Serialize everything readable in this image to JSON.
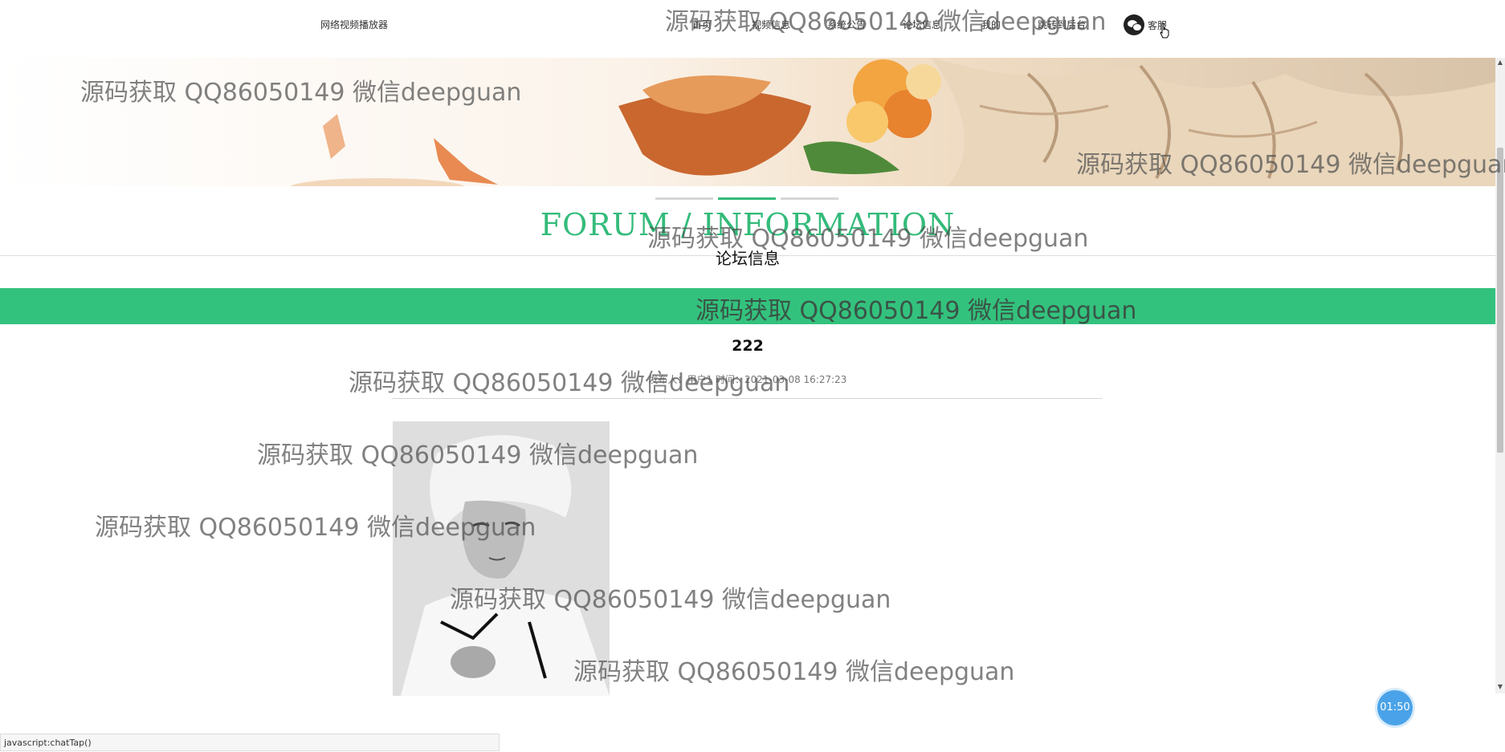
{
  "nav": {
    "brand": "网络视频播放器",
    "links": [
      "首页",
      "视频信息",
      "系统公告",
      "论坛信息",
      "我的",
      "跳转到后台"
    ],
    "service_label": "客服"
  },
  "section": {
    "title_en": "FORUM / INFORMATION",
    "title_cn": "论坛信息"
  },
  "post": {
    "title": "222",
    "meta": "发布人：用户1  时间：2021-03-08 16:27:23"
  },
  "slider": {
    "count": 3,
    "active_index": 1
  },
  "timer": "01:50",
  "status_bar": "javascript:chatTap()",
  "watermark": "源码获取 QQ86050149 微信deepguan",
  "colors": {
    "accent": "#33c27d",
    "timer": "#4aa3e8"
  },
  "icons": {
    "service": "wechat-icon",
    "cursor": "hand-cursor-icon"
  }
}
